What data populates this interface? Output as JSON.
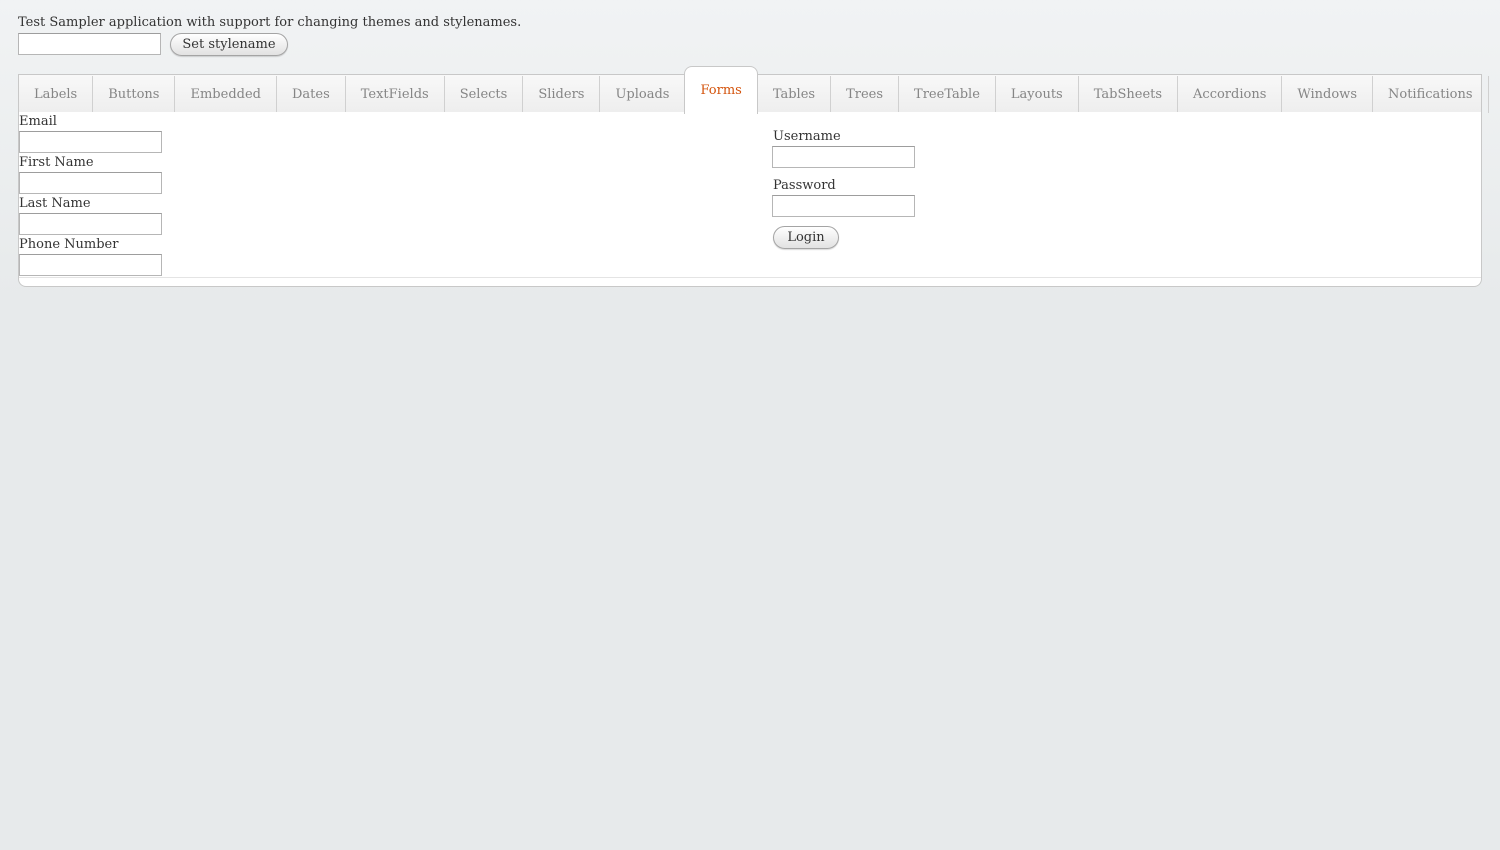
{
  "header": {
    "intro_text": "Test Sampler application with support for changing themes and stylenames.",
    "stylename_input_value": "",
    "set_stylename_label": "Set stylename"
  },
  "tabs": [
    {
      "label": "Labels",
      "selected": false
    },
    {
      "label": "Buttons",
      "selected": false
    },
    {
      "label": "Embedded",
      "selected": false
    },
    {
      "label": "Dates",
      "selected": false
    },
    {
      "label": "TextFields",
      "selected": false
    },
    {
      "label": "Selects",
      "selected": false
    },
    {
      "label": "Sliders",
      "selected": false
    },
    {
      "label": "Uploads",
      "selected": false
    },
    {
      "label": "Forms",
      "selected": true
    },
    {
      "label": "Tables",
      "selected": false
    },
    {
      "label": "Trees",
      "selected": false
    },
    {
      "label": "TreeTable",
      "selected": false
    },
    {
      "label": "Layouts",
      "selected": false
    },
    {
      "label": "TabSheets",
      "selected": false
    },
    {
      "label": "Accordions",
      "selected": false
    },
    {
      "label": "Windows",
      "selected": false
    },
    {
      "label": "Notifications",
      "selected": false
    }
  ],
  "form": {
    "email_label": "Email",
    "email_value": "",
    "first_name_label": "First Name",
    "first_name_value": "",
    "last_name_label": "Last Name",
    "last_name_value": "",
    "phone_label": "Phone Number",
    "phone_value": ""
  },
  "login": {
    "username_label": "Username",
    "username_value": "",
    "password_label": "Password",
    "password_value": "",
    "login_label": "Login"
  },
  "colors": {
    "selected_tab_text": "#d4540d",
    "tab_text": "#858585",
    "background": "#e7eaeb"
  }
}
